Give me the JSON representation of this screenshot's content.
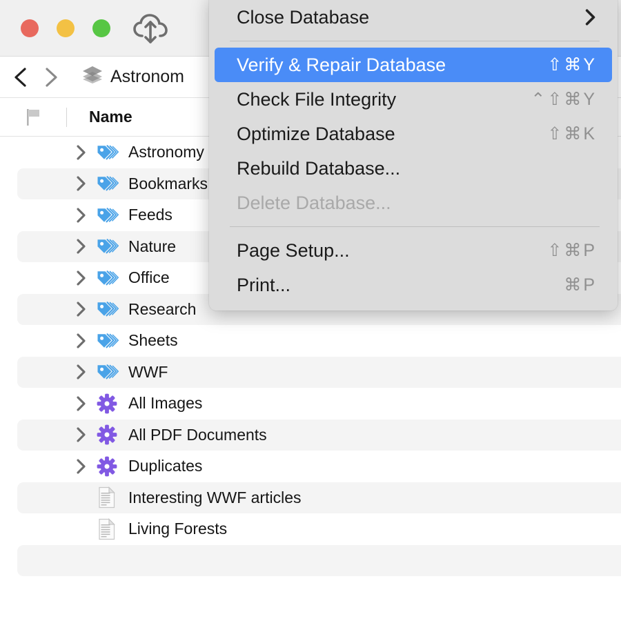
{
  "window": {
    "traffic_lights": [
      {
        "name": "close",
        "color": "#e8695e"
      },
      {
        "name": "minimize",
        "color": "#f3c144"
      },
      {
        "name": "zoom",
        "color": "#57c644"
      }
    ],
    "sync_icon": "cloud-sync-icon"
  },
  "navbar": {
    "back_icon": "chevron-left-icon",
    "forward_icon": "chevron-right-icon",
    "breadcrumb_icon": "layers-stack-icon",
    "breadcrumb_label": "Astronom"
  },
  "column_header": {
    "flag_icon": "flag-icon",
    "name_label": "Name"
  },
  "list": {
    "rows": [
      {
        "label": "Astronomy",
        "icon": "tag-icon",
        "disclosure": true,
        "striped": false
      },
      {
        "label": "Bookmarks",
        "icon": "tag-icon",
        "disclosure": true,
        "striped": true
      },
      {
        "label": "Feeds",
        "icon": "tag-icon",
        "disclosure": true,
        "striped": false
      },
      {
        "label": "Nature",
        "icon": "tag-icon",
        "disclosure": true,
        "striped": true
      },
      {
        "label": "Office",
        "icon": "tag-icon",
        "disclosure": true,
        "striped": false
      },
      {
        "label": "Research",
        "icon": "tag-icon",
        "disclosure": true,
        "striped": true
      },
      {
        "label": "Sheets",
        "icon": "tag-icon",
        "disclosure": true,
        "striped": false
      },
      {
        "label": "WWF",
        "icon": "tag-icon",
        "disclosure": true,
        "striped": true
      },
      {
        "label": "All Images",
        "icon": "gear-icon",
        "disclosure": true,
        "striped": false
      },
      {
        "label": "All PDF Documents",
        "icon": "gear-icon",
        "disclosure": true,
        "striped": true
      },
      {
        "label": "Duplicates",
        "icon": "gear-icon",
        "disclosure": true,
        "striped": false
      },
      {
        "label": "Interesting WWF articles",
        "icon": "document-icon",
        "disclosure": false,
        "striped": true
      },
      {
        "label": "Living Forests",
        "icon": "document-icon",
        "disclosure": false,
        "striped": false
      },
      {
        "label": "",
        "icon": "",
        "disclosure": false,
        "striped": true
      }
    ]
  },
  "menu": {
    "items": [
      {
        "label": "Close Database",
        "shortcut": "",
        "submenu": true,
        "selected": false,
        "disabled": false,
        "separator_after": true
      },
      {
        "label": "Verify & Repair Database",
        "shortcut": "⇧⌘Y",
        "submenu": false,
        "selected": true,
        "disabled": false,
        "separator_after": false
      },
      {
        "label": "Check File Integrity",
        "shortcut": "⌃⇧⌘Y",
        "submenu": false,
        "selected": false,
        "disabled": false,
        "separator_after": false
      },
      {
        "label": "Optimize Database",
        "shortcut": "⇧⌘K",
        "submenu": false,
        "selected": false,
        "disabled": false,
        "separator_after": false
      },
      {
        "label": "Rebuild Database...",
        "shortcut": "",
        "submenu": false,
        "selected": false,
        "disabled": false,
        "separator_after": false
      },
      {
        "label": "Delete Database...",
        "shortcut": "",
        "submenu": false,
        "selected": false,
        "disabled": true,
        "separator_after": true
      },
      {
        "label": "Page Setup...",
        "shortcut": "⇧⌘P",
        "submenu": false,
        "selected": false,
        "disabled": false,
        "separator_after": false
      },
      {
        "label": "Print...",
        "shortcut": "⌘P",
        "submenu": false,
        "selected": false,
        "disabled": false,
        "separator_after": false
      }
    ],
    "highlight_color": "#4a8cf7",
    "background_color": "#dcdcdc"
  },
  "colors": {
    "tag_blue": "#4aa3e8",
    "gear_purple": "#8159e3",
    "titlebar": "#f0f0f0",
    "stripe": "#f4f4f4"
  }
}
